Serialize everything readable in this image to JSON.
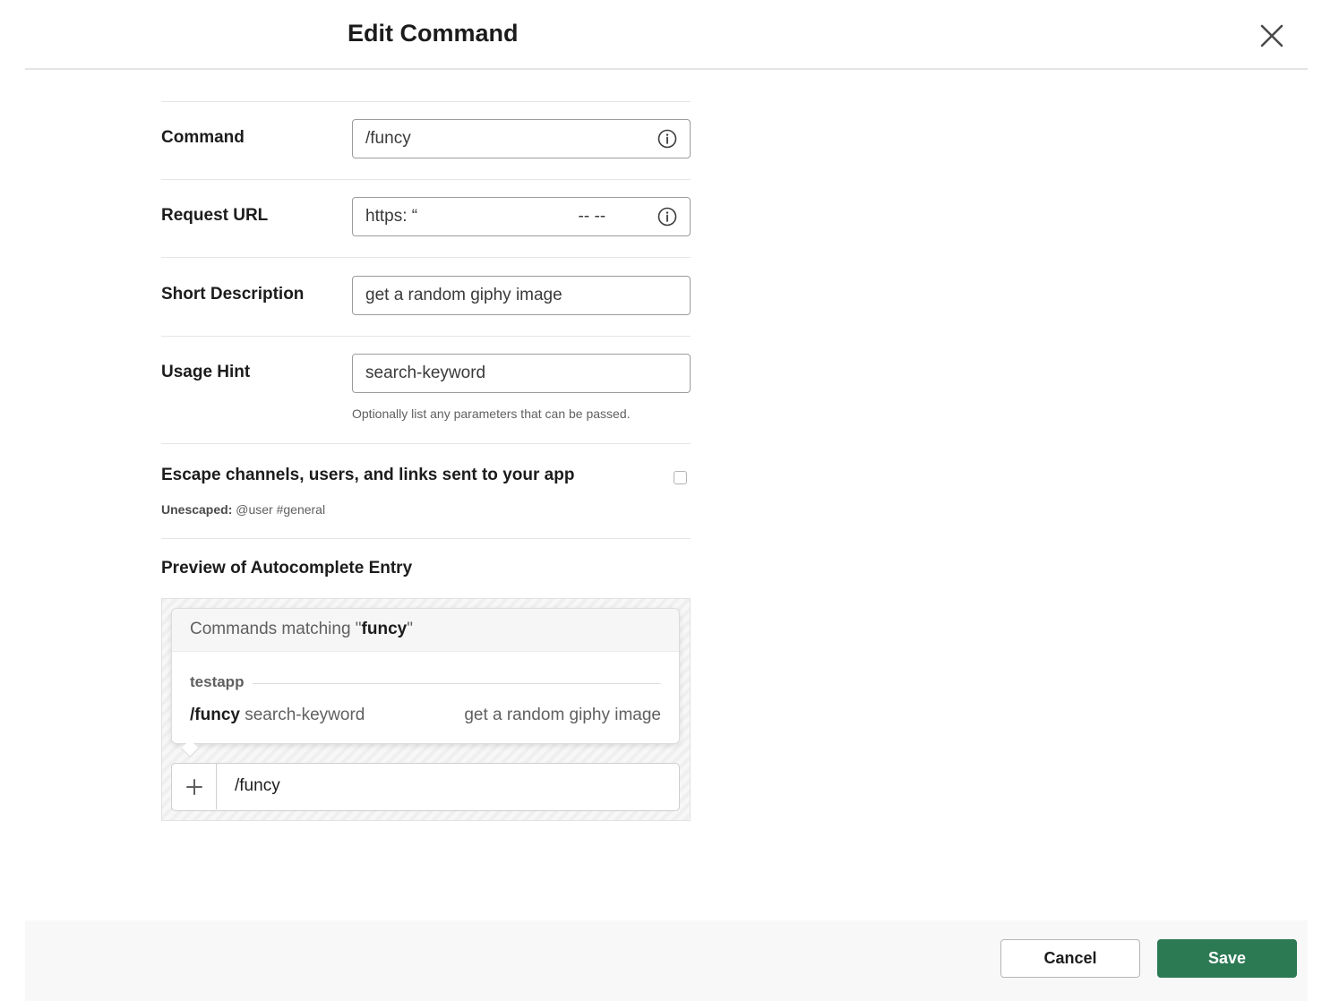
{
  "dialog": {
    "title": "Edit Command",
    "close_icon": "close-icon"
  },
  "form": {
    "command": {
      "label": "Command",
      "value": "/funcy",
      "icon": "info-icon"
    },
    "request_url": {
      "label": "Request URL",
      "value": "https: “                                  -- --",
      "icon": "info-icon"
    },
    "short_description": {
      "label": "Short Description",
      "value": "get a random giphy image"
    },
    "usage_hint": {
      "label": "Usage Hint",
      "value": "search-keyword",
      "hint": "Optionally list any parameters that can be passed."
    },
    "escape": {
      "label": "Escape channels, users, and links sent to your app",
      "sub_label": "Unescaped:",
      "sub_value": "@user #general",
      "checked": false
    }
  },
  "preview": {
    "title": "Preview of Autocomplete Entry",
    "header_prefix": "Commands matching \"",
    "header_term": "funcy",
    "header_suffix": "\"",
    "group": "testapp",
    "command": "/funcy",
    "usage": "search-keyword",
    "description": "get a random giphy image",
    "message_text": "/funcy",
    "plus_icon": "plus-icon"
  },
  "footer": {
    "cancel_label": "Cancel",
    "save_label": "Save",
    "save_color": "#2b7a54"
  }
}
